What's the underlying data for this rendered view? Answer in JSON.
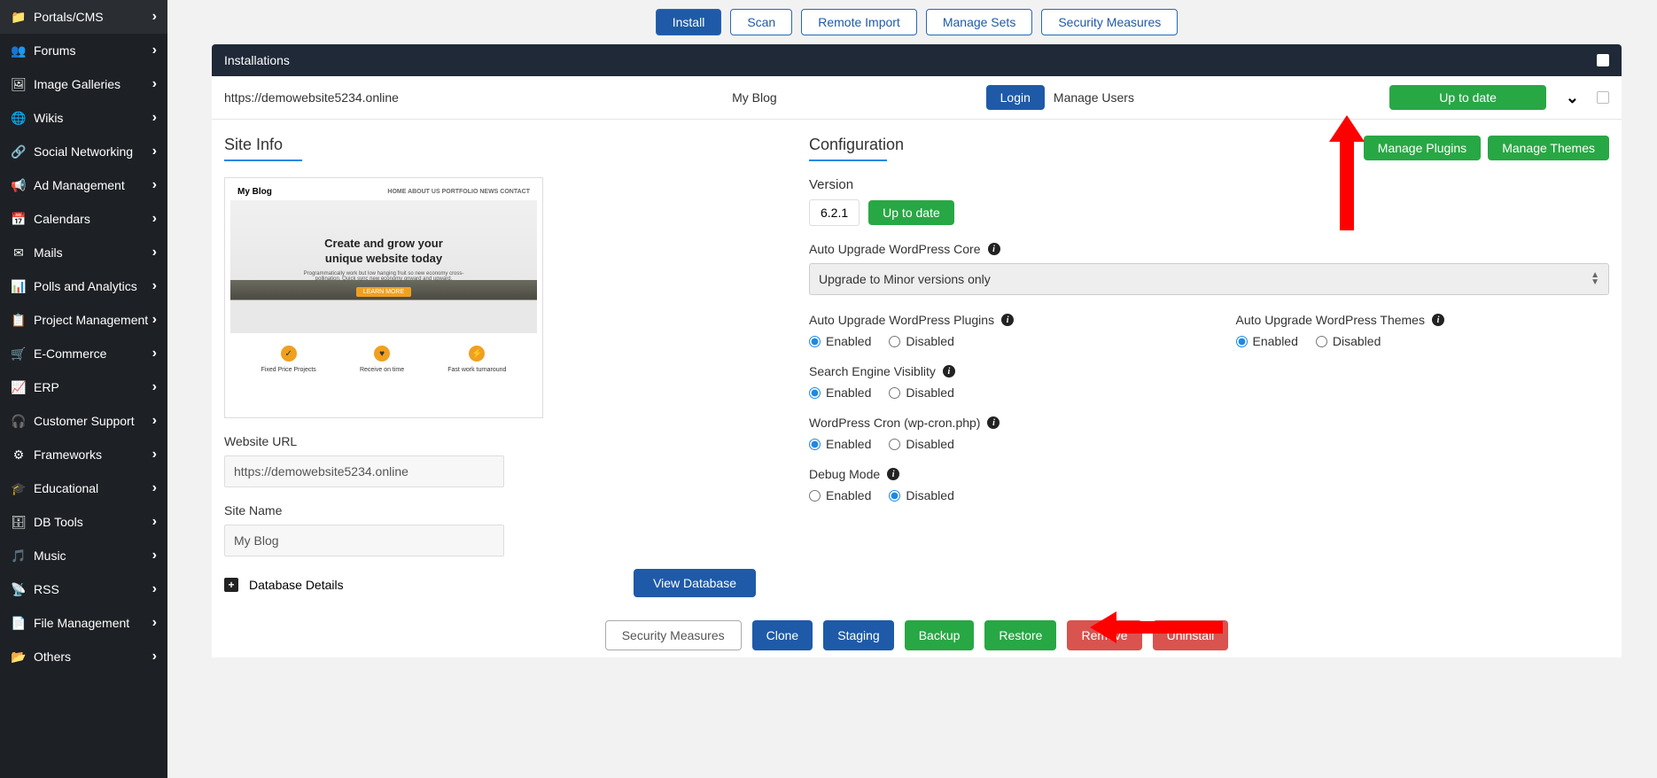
{
  "sidebar": {
    "items": [
      {
        "icon": "folder",
        "label": "Portals/CMS"
      },
      {
        "icon": "users",
        "label": "Forums"
      },
      {
        "icon": "image",
        "label": "Image Galleries"
      },
      {
        "icon": "globe",
        "label": "Wikis"
      },
      {
        "icon": "share",
        "label": "Social Networking"
      },
      {
        "icon": "megaphone",
        "label": "Ad Management"
      },
      {
        "icon": "calendar",
        "label": "Calendars"
      },
      {
        "icon": "mail",
        "label": "Mails"
      },
      {
        "icon": "chart-bar",
        "label": "Polls and Analytics"
      },
      {
        "icon": "clipboard",
        "label": "Project Management"
      },
      {
        "icon": "cart",
        "label": "E-Commerce"
      },
      {
        "icon": "erp",
        "label": "ERP"
      },
      {
        "icon": "headset",
        "label": "Customer Support"
      },
      {
        "icon": "gears",
        "label": "Frameworks"
      },
      {
        "icon": "grad-cap",
        "label": "Educational"
      },
      {
        "icon": "db",
        "label": "DB Tools"
      },
      {
        "icon": "music",
        "label": "Music"
      },
      {
        "icon": "rss",
        "label": "RSS"
      },
      {
        "icon": "file",
        "label": "File Management"
      },
      {
        "icon": "folder-open",
        "label": "Others"
      }
    ]
  },
  "tabs": [
    {
      "label": "Install",
      "active": true
    },
    {
      "label": "Scan",
      "active": false
    },
    {
      "label": "Remote Import",
      "active": false
    },
    {
      "label": "Manage Sets",
      "active": false
    },
    {
      "label": "Security Measures",
      "active": false
    }
  ],
  "panel": {
    "title": "Installations"
  },
  "installation": {
    "url": "https://demowebsite5234.online",
    "name": "My Blog",
    "login_label": "Login",
    "manage_users_label": "Manage Users",
    "status_label": "Up to date"
  },
  "site_info": {
    "title": "Site Info",
    "preview": {
      "site_title": "My Blog",
      "nav": "HOME   ABOUT US   PORTFOLIO   NEWS   CONTACT",
      "headline1": "Create and grow your",
      "headline2": "unique website today",
      "subtext": "Programmatically work but low hanging fruit so new economy cross-pollination. Quick sync new economy onward and upward.",
      "learn_label": "LEARN MORE",
      "features": [
        {
          "icon": "✓",
          "label": "Fixed Price Projects"
        },
        {
          "icon": "♥",
          "label": "Receive on time"
        },
        {
          "icon": "⚡",
          "label": "Fast work turnaround"
        }
      ]
    },
    "website_url_label": "Website URL",
    "website_url_value": "https://demowebsite5234.online",
    "site_name_label": "Site Name",
    "site_name_value": "My Blog",
    "db_details_label": "Database Details",
    "view_db_label": "View Database"
  },
  "configuration": {
    "title": "Configuration",
    "manage_plugins_label": "Manage Plugins",
    "manage_themes_label": "Manage Themes",
    "version_label": "Version",
    "version_value": "6.2.1",
    "version_status": "Up to date",
    "auto_upgrade_core_label": "Auto Upgrade WordPress Core",
    "auto_upgrade_core_value": "Upgrade to Minor versions only",
    "plugins_label": "Auto Upgrade WordPress Plugins",
    "themes_label": "Auto Upgrade WordPress Themes",
    "search_visibility_label": "Search Engine Visiblity",
    "cron_label": "WordPress Cron (wp-cron.php)",
    "debug_label": "Debug Mode",
    "enabled_label": "Enabled",
    "disabled_label": "Disabled"
  },
  "bottom_actions": {
    "security_label": "Security Measures",
    "clone_label": "Clone",
    "staging_label": "Staging",
    "backup_label": "Backup",
    "restore_label": "Restore",
    "remove_label": "Remove",
    "uninstall_label": "Uninstall"
  },
  "icons": {
    "folder": "📁",
    "users": "👥",
    "image": "🖼",
    "globe": "🌐",
    "share": "🔗",
    "megaphone": "📢",
    "calendar": "📅",
    "mail": "✉",
    "chart-bar": "📊",
    "clipboard": "📋",
    "cart": "🛒",
    "erp": "📈",
    "headset": "🎧",
    "gears": "⚙",
    "grad-cap": "🎓",
    "db": "🗄",
    "music": "🎵",
    "rss": "📡",
    "file": "📄",
    "folder-open": "📂"
  }
}
